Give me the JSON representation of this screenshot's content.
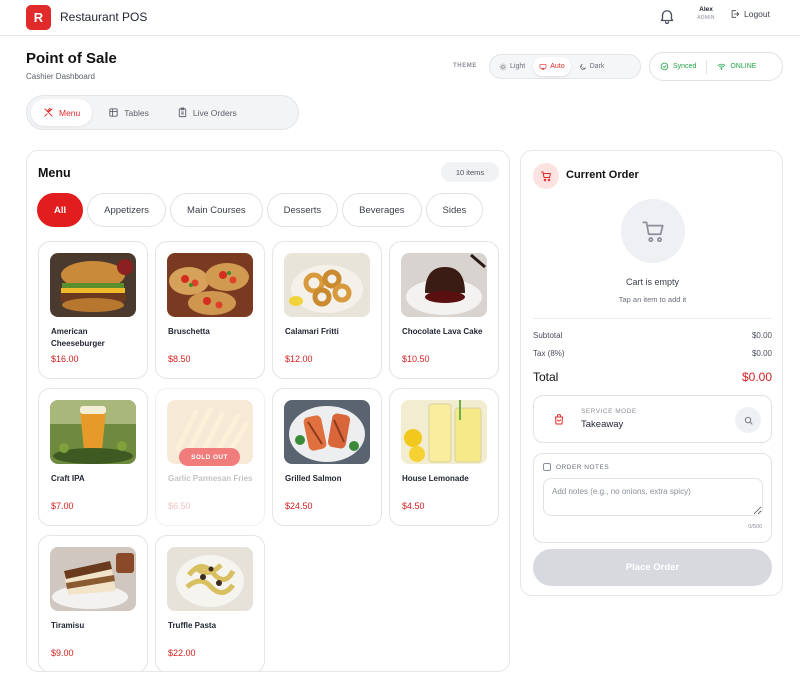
{
  "app": {
    "logo_letter": "R",
    "title": "Restaurant POS"
  },
  "user": {
    "name": "Alex",
    "role": "ADMIN",
    "logout_label": "Logout"
  },
  "page": {
    "title": "Point of Sale",
    "subtitle": "Cashier Dashboard"
  },
  "theme": {
    "label": "THEME",
    "options": [
      "Light",
      "Auto",
      "Dark"
    ],
    "selected": "Auto"
  },
  "status": {
    "sync": "Synced",
    "connection": "ONLINE",
    "color": "#22a347"
  },
  "tabs": [
    {
      "label": "Menu",
      "icon": "utensils-icon"
    },
    {
      "label": "Tables",
      "icon": "table-grid-icon"
    },
    {
      "label": "Live Orders",
      "icon": "clipboard-icon"
    }
  ],
  "menu": {
    "title": "Menu",
    "count": "10 items",
    "categories": [
      "All",
      "Appetizers",
      "Main Courses",
      "Desserts",
      "Beverages",
      "Sides"
    ],
    "selected_category": "All",
    "items": [
      {
        "name": "American Cheeseburger",
        "price": "$16.00",
        "sold_out": false
      },
      {
        "name": "Bruschetta",
        "price": "$8.50",
        "sold_out": false
      },
      {
        "name": "Calamari Fritti",
        "price": "$12.00",
        "sold_out": false
      },
      {
        "name": "Chocolate Lava Cake",
        "price": "$10.50",
        "sold_out": false
      },
      {
        "name": "Craft IPA",
        "price": "$7.00",
        "sold_out": false
      },
      {
        "name": "Garlic Parmesan Fries",
        "price": "$6.50",
        "sold_out": true,
        "badge": "SOLD OUT"
      },
      {
        "name": "Grilled Salmon",
        "price": "$24.50",
        "sold_out": false
      },
      {
        "name": "House Lemonade",
        "price": "$4.50",
        "sold_out": false
      },
      {
        "name": "Tiramisu",
        "price": "$9.00",
        "sold_out": false
      },
      {
        "name": "Truffle Pasta",
        "price": "$22.00",
        "sold_out": false
      }
    ]
  },
  "order": {
    "title": "Current Order",
    "empty_title": "Cart is empty",
    "empty_subtitle": "Tap an item to add it",
    "subtotal_label": "Subtotal",
    "subtotal_value": "$0.00",
    "tax_label": "Tax (8%)",
    "tax_value": "$0.00",
    "total_label": "Total",
    "total_value": "$0.00",
    "service_mode_label": "SERVICE MODE",
    "service_mode_value": "Takeaway",
    "notes_label": "ORDER NOTES",
    "notes_placeholder": "Add notes (e.g., no onions, extra spicy)",
    "notes_value": "",
    "notes_counter": "0/500",
    "place_order_label": "Place Order"
  },
  "colors": {
    "accent": "#e12b2b",
    "price": "#d41f1f",
    "online": "#22a347",
    "disabled_button": "#d7d9de"
  }
}
